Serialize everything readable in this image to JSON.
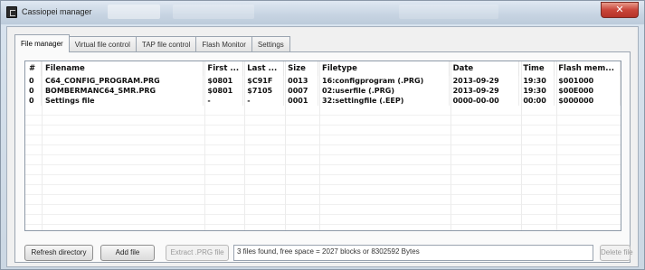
{
  "window": {
    "title": "Cassiopei manager",
    "close_glyph": "✕"
  },
  "tabs": [
    {
      "label": "File manager",
      "active": true
    },
    {
      "label": "Virtual file control",
      "active": false
    },
    {
      "label": "TAP file control",
      "active": false
    },
    {
      "label": "Flash Monitor",
      "active": false
    },
    {
      "label": "Settings",
      "active": false
    }
  ],
  "table": {
    "columns": [
      "#",
      "Filename",
      "First ...",
      "Last ...",
      "Size",
      "Filetype",
      "Date",
      "Time",
      "Flash mem..."
    ],
    "rows": [
      [
        "0",
        "C64_CONFIG_PROGRAM.PRG",
        "$0801",
        "$C91F",
        "0013",
        "16:configprogram (.PRG)",
        "2013-09-29",
        "19:30",
        "$001000"
      ],
      [
        "0",
        "BOMBERMANC64_SMR.PRG",
        "$0801",
        "$7105",
        "0007",
        "02:userfile (.PRG)",
        "2013-09-29",
        "19:30",
        "$00E000"
      ],
      [
        "0",
        "Settings file",
        "-",
        "-",
        "0001",
        "32:settingfile (.EEP)",
        "0000-00-00",
        "00:00",
        "$000000"
      ]
    ]
  },
  "buttons": {
    "refresh": "Refresh directory",
    "add": "Add file",
    "extract": "Extract .PRG file",
    "delete": "Delete file"
  },
  "status": "3 files found, free space = 2027 blocks or 8302592 Bytes",
  "colors": {
    "close_button": "#c9453a",
    "titlebar": "#c7d4e2",
    "panel_bg": "#f0f0f0"
  }
}
